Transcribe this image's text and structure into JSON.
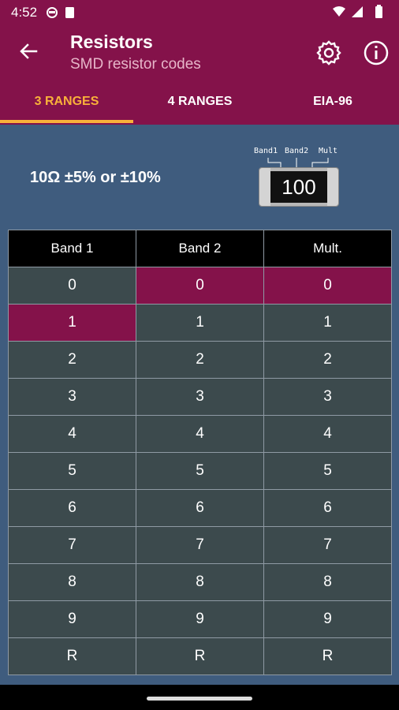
{
  "status": {
    "time": "4:52"
  },
  "appbar": {
    "title": "Resistors",
    "subtitle": "SMD resistor codes"
  },
  "tabs": [
    {
      "label": "3 RANGES",
      "active": true
    },
    {
      "label": "4 RANGES",
      "active": false
    },
    {
      "label": "EIA-96",
      "active": false
    }
  ],
  "result": {
    "text": "10Ω ±5%  or ±10%"
  },
  "chip": {
    "labels": [
      "Band1",
      "Band2",
      "Mult"
    ],
    "code": "100"
  },
  "table": {
    "headers": [
      "Band 1",
      "Band 2",
      "Mult."
    ],
    "rows": [
      [
        "0",
        "0",
        "0"
      ],
      [
        "1",
        "1",
        "1"
      ],
      [
        "2",
        "2",
        "2"
      ],
      [
        "3",
        "3",
        "3"
      ],
      [
        "4",
        "4",
        "4"
      ],
      [
        "5",
        "5",
        "5"
      ],
      [
        "6",
        "6",
        "6"
      ],
      [
        "7",
        "7",
        "7"
      ],
      [
        "8",
        "8",
        "8"
      ],
      [
        "9",
        "9",
        "9"
      ],
      [
        "R",
        "R",
        "R"
      ]
    ],
    "selected": {
      "band1": "1",
      "band2": "0",
      "mult": "0"
    }
  },
  "colors": {
    "primary": "#84124a",
    "accent": "#f9b13a",
    "background": "#3f5c7e",
    "cell": "#3c4a4d"
  },
  "icons": {
    "back": "arrow-back-icon",
    "settings": "gear-icon",
    "info": "info-icon"
  }
}
